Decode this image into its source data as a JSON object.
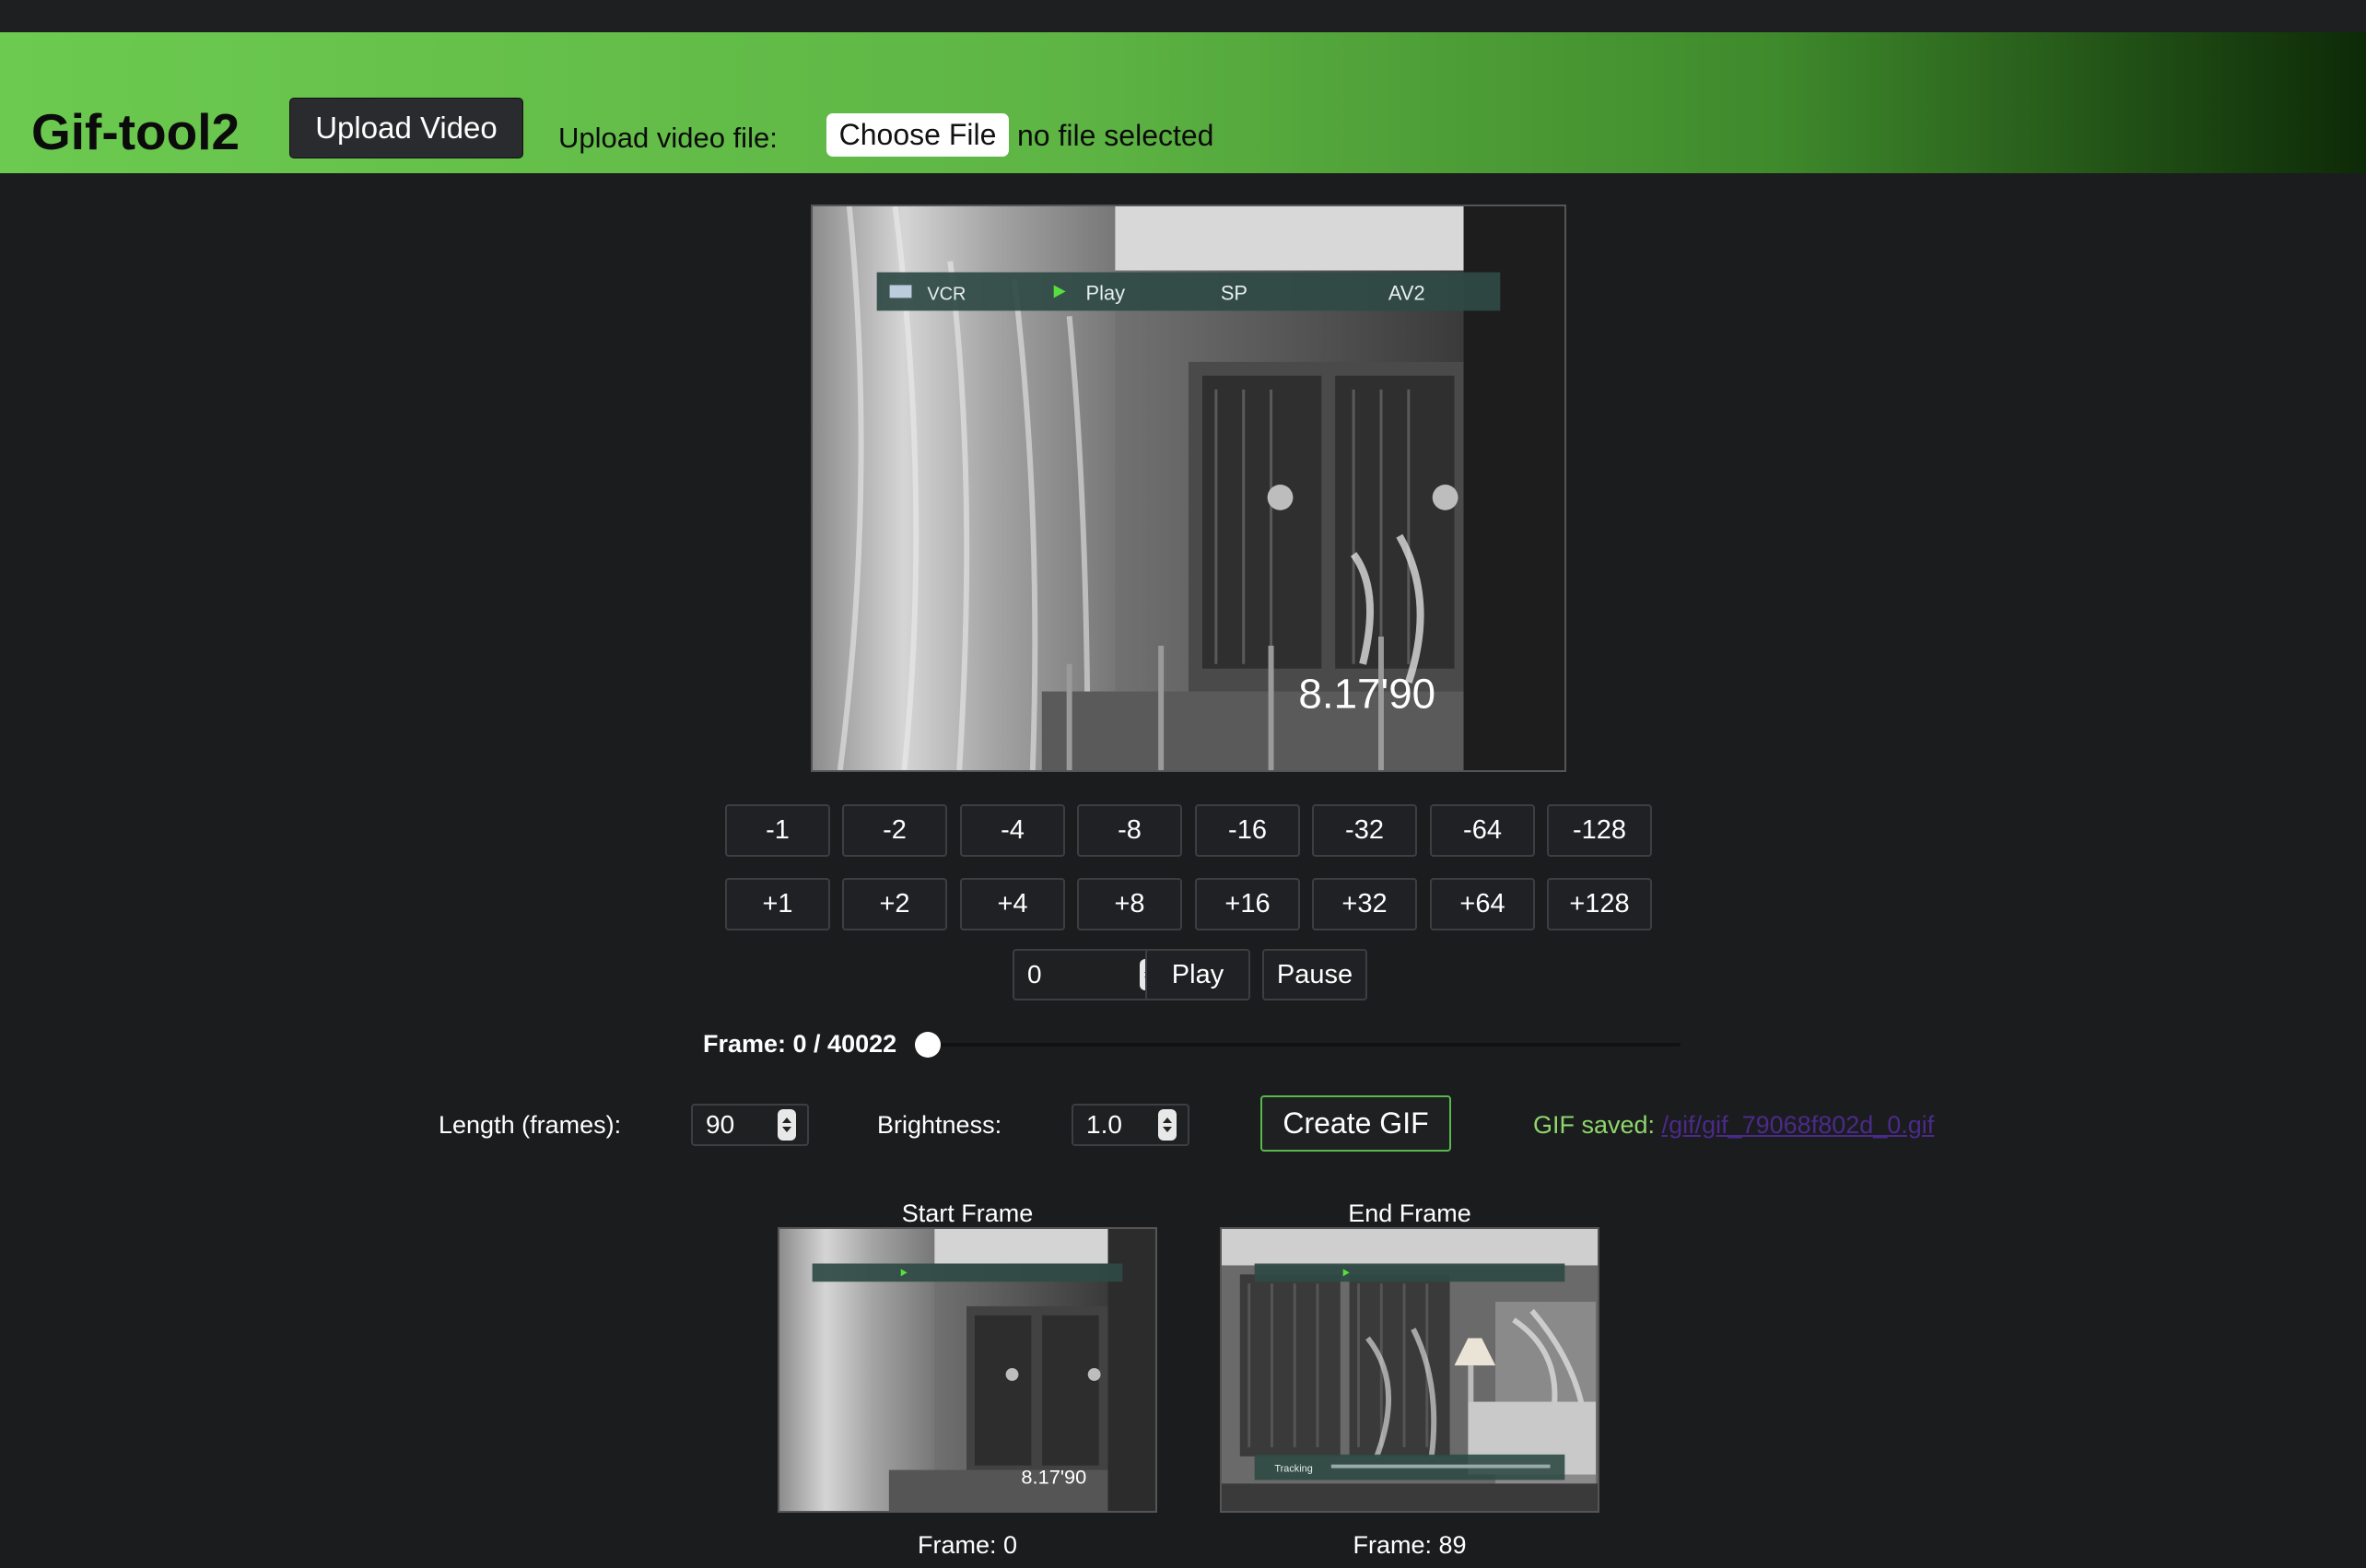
{
  "header": {
    "app_title": "Gif-tool2",
    "upload_button": "Upload Video",
    "upload_label": "Upload video file:",
    "choose_file": "Choose File",
    "file_status": "no file selected"
  },
  "video": {
    "osd": {
      "source": "VCR",
      "mode": "Play",
      "speed": "SP",
      "input": "AV2"
    },
    "timestamp": "8.17'90"
  },
  "step_back": [
    "-1",
    "-2",
    "-4",
    "-8",
    "-16",
    "-32",
    "-64",
    "-128"
  ],
  "step_forward": [
    "+1",
    "+2",
    "+4",
    "+8",
    "+16",
    "+32",
    "+64",
    "+128"
  ],
  "playback": {
    "frame_input": "0",
    "play": "Play",
    "pause": "Pause"
  },
  "slider": {
    "label": "Frame: 0 / 40022",
    "current": 0,
    "max": 40022
  },
  "controls": {
    "length_label": "Length (frames):",
    "length_value": "90",
    "brightness_label": "Brightness:",
    "brightness_value": "1.0",
    "create_gif": "Create GIF",
    "gif_saved_label": "GIF saved:",
    "gif_saved_link": "/gif/gif_79068f802d_0.gif"
  },
  "thumbnails": {
    "start": {
      "title": "Start Frame",
      "frame": "Frame: 0"
    },
    "end": {
      "title": "End Frame",
      "frame": "Frame: 89",
      "overlay": "Tracking"
    }
  },
  "colors": {
    "header_start": "#6cca50",
    "header_end": "#0d2a07",
    "accent_green": "#57b94c",
    "saved_text": "#8fd66b",
    "link": "#4b2a8a",
    "background": "#1b1c1e"
  }
}
